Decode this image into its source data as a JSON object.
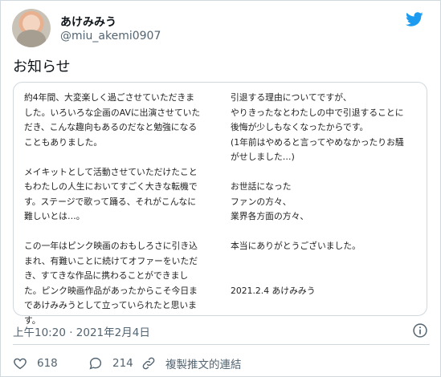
{
  "account": {
    "display_name": "あけみみう",
    "handle": "@miu_akemi0907"
  },
  "tweet": {
    "text": "お知らせ",
    "image_text_left": "約4年間、大変楽しく過ごさせていただきま\nした。いろいろな企画のAVに出演させていた\nだき、こんな趣向もあるのだなと勉強になる\nこともありました。\n\nメイキットとして活動させていただけたこと\nもわたしの人生においてすごく大きな転機で\nす。ステージで歌って踊る、それがこんなに\n難しいとは…。\n\nこの一年はピンク映画のおもしろさに引き込\nまれ、有難いことに続けてオファーをいただ\nき、すてきな作品に携わることができまし\nた。ピンク映画作品があったからこそ今日ま\nであけみみうとして立っていられたと思いま\nす。",
    "image_text_right": "引退する理由についてですが、\nやりきったなとわたしの中で引退することに\n後悔が少しもなくなったからです。\n(1年前はやめると言ってやめなかったりお騒\nがせしました…)\n\nお世話になった\nファンの方々、\n業界各方面の方々、\n\n本当にありがとうございました。\n\n\n2021.2.4 あけみみう",
    "timestamp": "上午10:20 · 2021年2月4日"
  },
  "actions": {
    "likes": "618",
    "replies": "214",
    "copy_link_label": "複製推文的連結"
  },
  "colors": {
    "twitter_blue": "#1d9bf0",
    "muted": "#536471",
    "border": "#cfd9de"
  }
}
